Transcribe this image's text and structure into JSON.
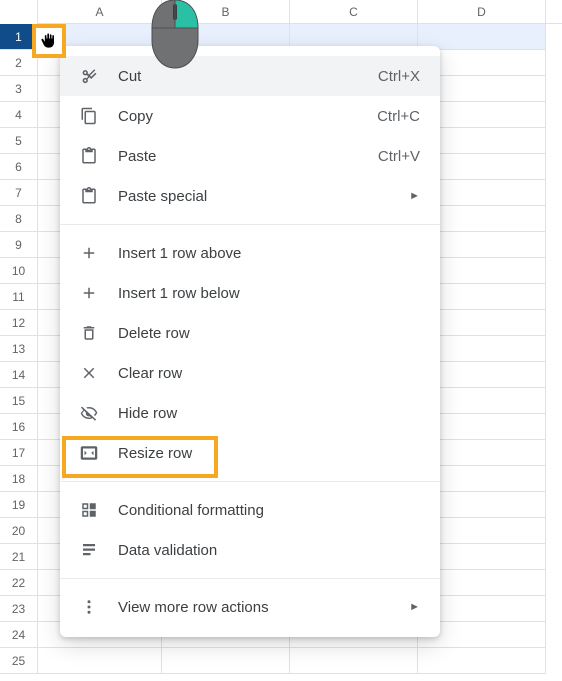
{
  "columns": [
    "A",
    "B",
    "C",
    "D"
  ],
  "row_count": 25,
  "selected_row": 1,
  "menu": {
    "cut": "Cut",
    "cut_sc": "Ctrl+X",
    "copy": "Copy",
    "copy_sc": "Ctrl+C",
    "paste": "Paste",
    "paste_sc": "Ctrl+V",
    "paste_special": "Paste special",
    "insert_above": "Insert 1 row above",
    "insert_below": "Insert 1 row below",
    "delete_row": "Delete row",
    "clear_row": "Clear row",
    "hide_row": "Hide row",
    "resize_row": "Resize row",
    "cond_format": "Conditional formatting",
    "data_validation": "Data validation",
    "more_actions": "View more row actions"
  },
  "submenu_arrow": "►"
}
